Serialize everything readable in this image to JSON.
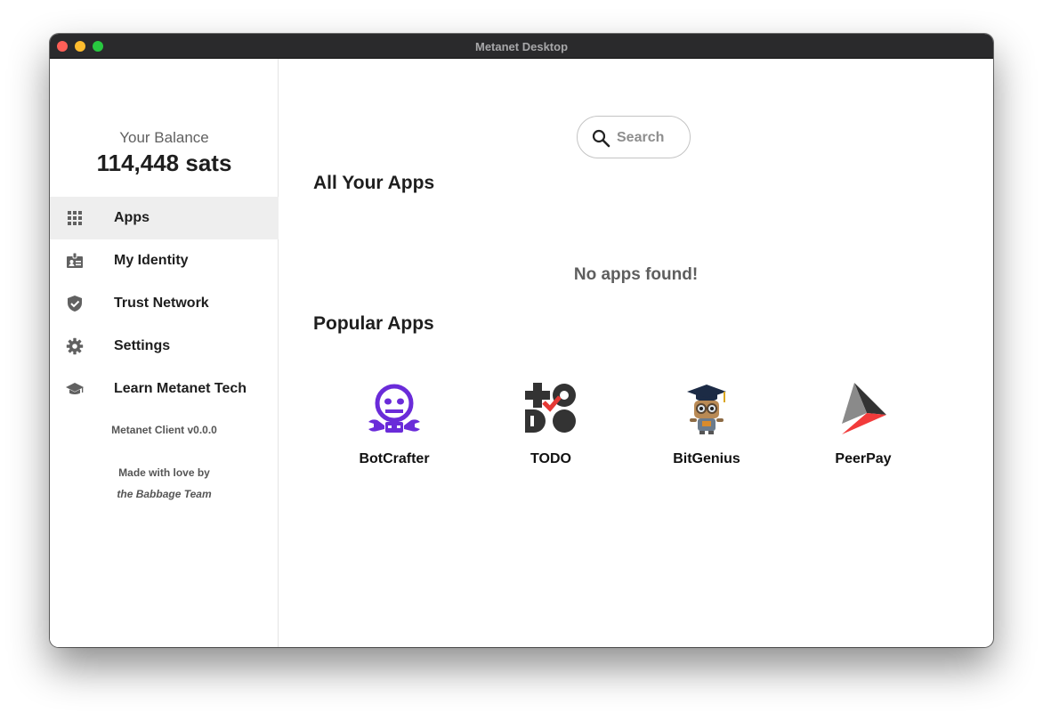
{
  "window": {
    "title": "Metanet Desktop"
  },
  "sidebar": {
    "balance_label": "Your Balance",
    "balance_value": "114,448 sats",
    "items": [
      {
        "label": "Apps",
        "icon": "grid-icon",
        "active": true
      },
      {
        "label": "My Identity",
        "icon": "id-badge-icon",
        "active": false
      },
      {
        "label": "Trust Network",
        "icon": "shield-check-icon",
        "active": false
      },
      {
        "label": "Settings",
        "icon": "gear-icon",
        "active": false
      },
      {
        "label": "Learn Metanet Tech",
        "icon": "graduation-cap-icon",
        "active": false
      }
    ],
    "version": "Metanet Client v0.0.0",
    "made_with_love": "Made with love by",
    "team": "the Babbage Team"
  },
  "main": {
    "search": {
      "placeholder": "Search",
      "value": ""
    },
    "all_apps_title": "All Your Apps",
    "empty_message": "No apps found!",
    "popular_title": "Popular Apps",
    "popular_apps": [
      {
        "name": "BotCrafter",
        "icon": "botcrafter-icon"
      },
      {
        "name": "TODO",
        "icon": "todo-icon"
      },
      {
        "name": "BitGenius",
        "icon": "bitgenius-icon"
      },
      {
        "name": "PeerPay",
        "icon": "peerpay-icon"
      }
    ]
  },
  "colors": {
    "titlebar": "#2a2a2c",
    "active_nav": "#eeeeee",
    "botcrafter_purple": "#6a2bd9",
    "todo_red": "#e53935",
    "peerpay_red": "#f23b3b"
  }
}
